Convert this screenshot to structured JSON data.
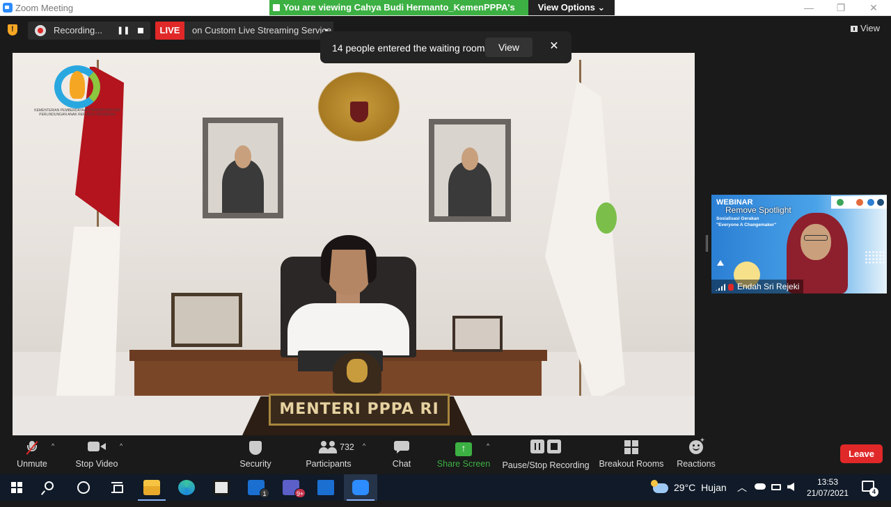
{
  "window": {
    "title": "Zoom Meeting",
    "minimize": "—",
    "restore": "❐",
    "close": "✕"
  },
  "share_banner": {
    "text": "You are viewing Cahya Budi Hermanto_KemenPPPA's screen",
    "view_options": "View Options ⌄",
    "color": "#3cb043"
  },
  "top_bar": {
    "recording_label": "Recording...",
    "pause_glyph": "❚❚",
    "live_label": "LIVE",
    "live_service": "on Custom Live Streaming Service",
    "live_caret": "▼",
    "view_label": "View"
  },
  "waiting_toast": {
    "message": "14 people entered the waiting room",
    "view_button": "View",
    "close_glyph": "✕"
  },
  "main_video": {
    "nameplate": "MENTERI PPPA RI",
    "logo_caption": "KEMENTERIAN PEMBERDAYAAN PEREMPUAN DAN PERLINDUNGAN ANAK REPUBLIK INDONESIA"
  },
  "spotlight_tile": {
    "webinar_title": "WEBINAR",
    "subtitle_1": "Sosialisasi Gerakan",
    "subtitle_2": "\"Everyone A Changemaker\"",
    "remove_spotlight": "Remove Spotlight",
    "participant_name": "Endah Sri Rejeki"
  },
  "toolbar": {
    "unmute": "Unmute",
    "stop_video": "Stop Video",
    "security": "Security",
    "participants": "Participants",
    "participants_count": "732",
    "chat": "Chat",
    "share_screen": "Share Screen",
    "pause_stop_recording": "Pause/Stop Recording",
    "breakout_rooms": "Breakout Rooms",
    "reactions": "Reactions",
    "leave": "Leave",
    "caret": "^",
    "reactions_plus": "+"
  },
  "taskbar": {
    "mail_badge": "1",
    "teams_badge": "9+",
    "weather_temp": "29°C",
    "weather_desc": "Hujan",
    "time": "13:53",
    "date": "21/07/2021",
    "notifications": "4",
    "tray_chevron": "︿"
  },
  "colors": {
    "live_red": "#e02828",
    "leave_red": "#e02828",
    "share_green": "#3cb043",
    "zoom_blue": "#2d8cff"
  }
}
